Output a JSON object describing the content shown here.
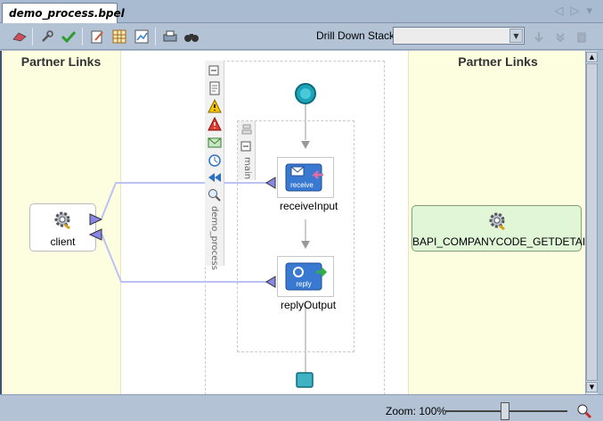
{
  "tab": {
    "label": "demo_process.bpel"
  },
  "toolbar": {
    "drill_down_label": "Drill Down Stack:",
    "drill_down_value": ""
  },
  "canvas": {
    "left_panel_title": "Partner Links",
    "right_panel_title": "Partner Links",
    "process_label": "demo_process",
    "scope_label": "main",
    "activities": [
      {
        "label": "receiveInput",
        "type_text": "receive"
      },
      {
        "label": "replyOutput",
        "type_text": "reply"
      }
    ],
    "partner_links": [
      {
        "label": "client"
      },
      {
        "label": "BAPI_COMPANYCODE_GETDETAIL"
      }
    ]
  },
  "status": {
    "zoom_label": "Zoom: 100%",
    "zoom_percent": 100
  },
  "colors": {
    "partner_panel_bg": "#fdfde0",
    "connector": "#bcc3f4",
    "green_box": "#e1f5d7",
    "start_node": "#1da3b8"
  }
}
